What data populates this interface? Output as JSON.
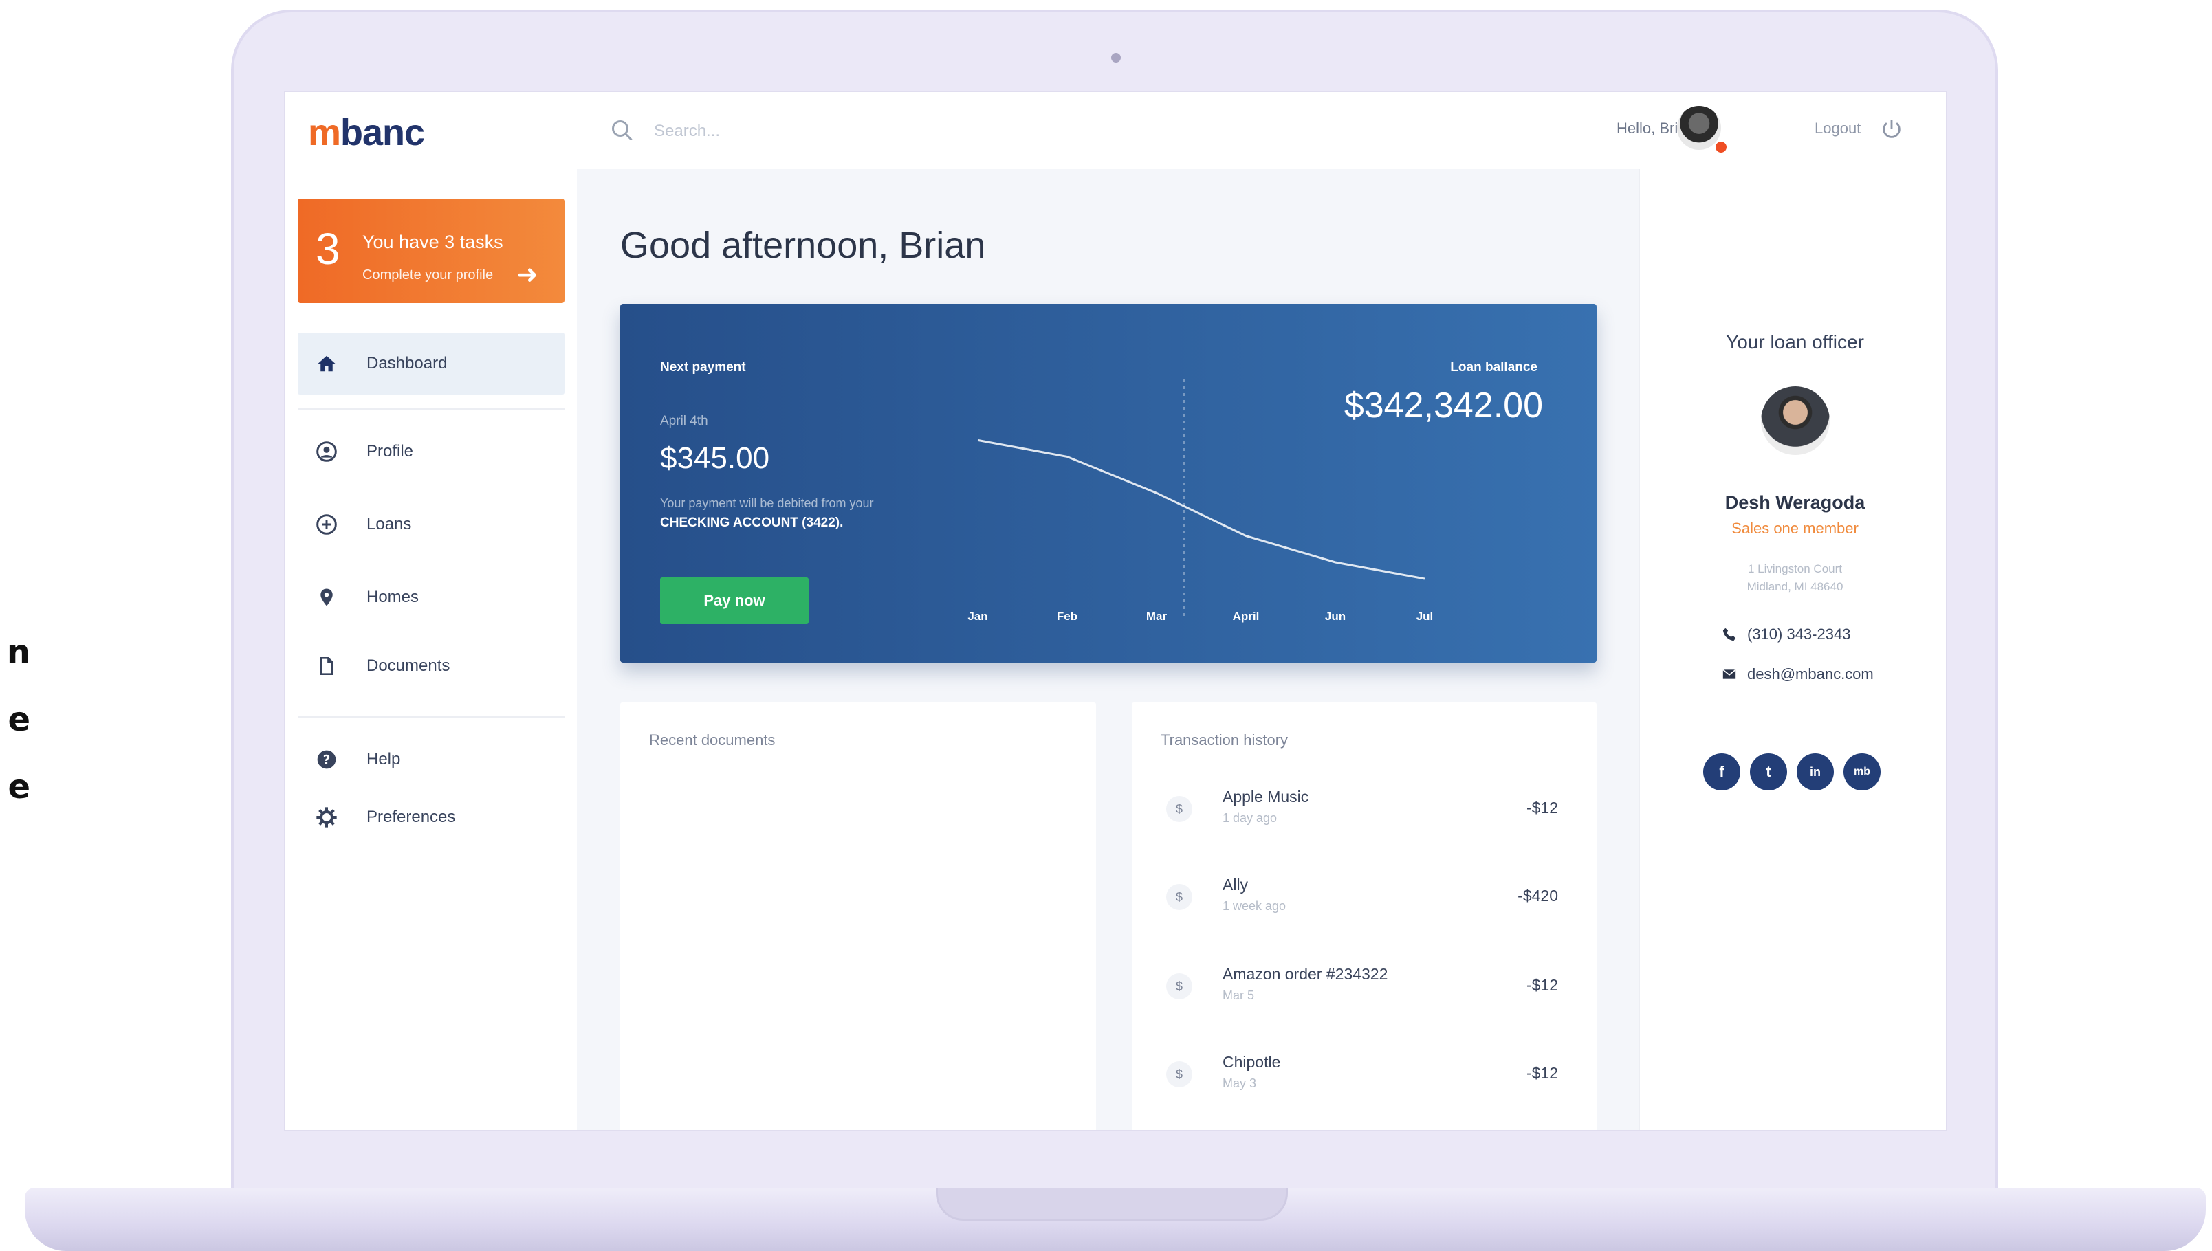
{
  "side_text": [
    "n",
    "e",
    "e"
  ],
  "app": {
    "logo_prefix": "m",
    "logo_rest": "banc"
  },
  "tasks": {
    "count": "3",
    "title": "You have 3 tasks",
    "subtitle": "Complete your profile",
    "accent": "#ef6a26"
  },
  "sidebar": {
    "items": [
      {
        "label": "Dashboard",
        "icon": "home-icon",
        "active": true
      },
      {
        "label": "Profile",
        "icon": "user-icon"
      },
      {
        "label": "Loans",
        "icon": "loans-icon"
      },
      {
        "label": "Homes",
        "icon": "location-pin-icon"
      },
      {
        "label": "Documents",
        "icon": "document-icon"
      },
      {
        "label": "Help",
        "icon": "help-icon"
      },
      {
        "label": "Preferences",
        "icon": "gear-icon"
      }
    ]
  },
  "topbar": {
    "search_placeholder": "Search...",
    "greeting": "Hello, Brian",
    "logout": "Logout"
  },
  "main": {
    "title": "Good afternoon, Brian"
  },
  "hero": {
    "next_payment_label": "Next payment",
    "date": "April 4th",
    "amount": "$345.00",
    "note_line1": "Your payment will be debited from your",
    "note_line2": "CHECKING ACCOUNT (3422).",
    "pay_button": "Pay now",
    "balance_label": "Loan ballance",
    "balance_amount": "$342,342.00"
  },
  "chart_data": {
    "type": "line",
    "categories": [
      "Jan",
      "Feb",
      "Mar",
      "April",
      "Jun",
      "Jul"
    ],
    "series": [
      {
        "values": [
          2.1,
          1.85,
          1.3,
          0.65,
          0.25,
          0.0
        ]
      }
    ],
    "ylim": [
      0,
      2.5
    ],
    "grid": false,
    "marker": "Mar",
    "line_color": "#ffffff"
  },
  "recent_documents": {
    "title": "Recent documents"
  },
  "transactions": {
    "title": "Transaction history",
    "items": [
      {
        "name": "Apple Music",
        "time": "1 day ago",
        "amount": "-$12"
      },
      {
        "name": "Ally",
        "time": "1 week ago",
        "amount": "-$420"
      },
      {
        "name": "Amazon order #234322",
        "time": "Mar 5",
        "amount": "-$12"
      },
      {
        "name": "Chipotle",
        "time": "May 3",
        "amount": "-$12"
      }
    ]
  },
  "loan_officer": {
    "heading": "Your loan officer",
    "name": "Desh Weragoda",
    "role": "Sales one member",
    "address_line1": "1 Livingston Court",
    "address_line2": "Midland, MI 48640",
    "phone": "(310) 343-2343",
    "email": "desh@mbanc.com",
    "socials": [
      {
        "label": "f",
        "icon": "facebook-icon"
      },
      {
        "label": "t",
        "icon": "twitter-icon"
      },
      {
        "label": "in",
        "icon": "linkedin-icon"
      },
      {
        "label": "mb",
        "icon": "mbanc-icon"
      }
    ]
  }
}
